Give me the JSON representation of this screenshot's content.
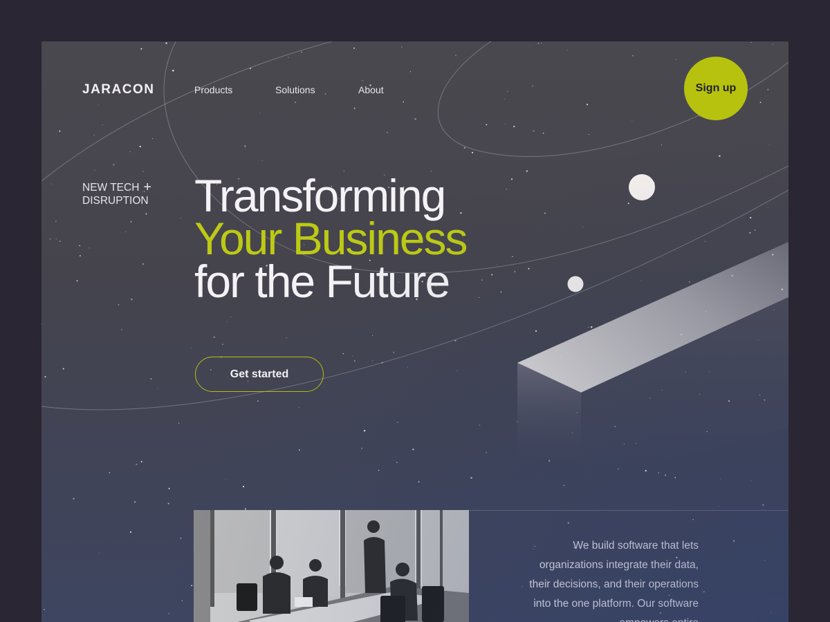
{
  "brand": {
    "name": "JARACON"
  },
  "nav": {
    "items": [
      {
        "label": "Products"
      },
      {
        "label": "Solutions"
      },
      {
        "label": "About"
      }
    ]
  },
  "header": {
    "signup_label": "Sign up"
  },
  "tagline": {
    "line1": "NEW TECH",
    "plus": "+",
    "line2": "DISRUPTION"
  },
  "hero": {
    "line1": "Transforming",
    "line2": "Your Business",
    "line3": "for the Future",
    "cta_label": "Get started"
  },
  "about": {
    "text": "We build software that lets organizations integrate their data, their decisions, and their operations into the one platform. Our software empowers entire"
  },
  "colors": {
    "accent": "#b7c20e",
    "outer_background": "#2b2633",
    "panel_top": "#4a484f",
    "panel_bottom": "#3e4560",
    "text": "#f4f2f5"
  }
}
